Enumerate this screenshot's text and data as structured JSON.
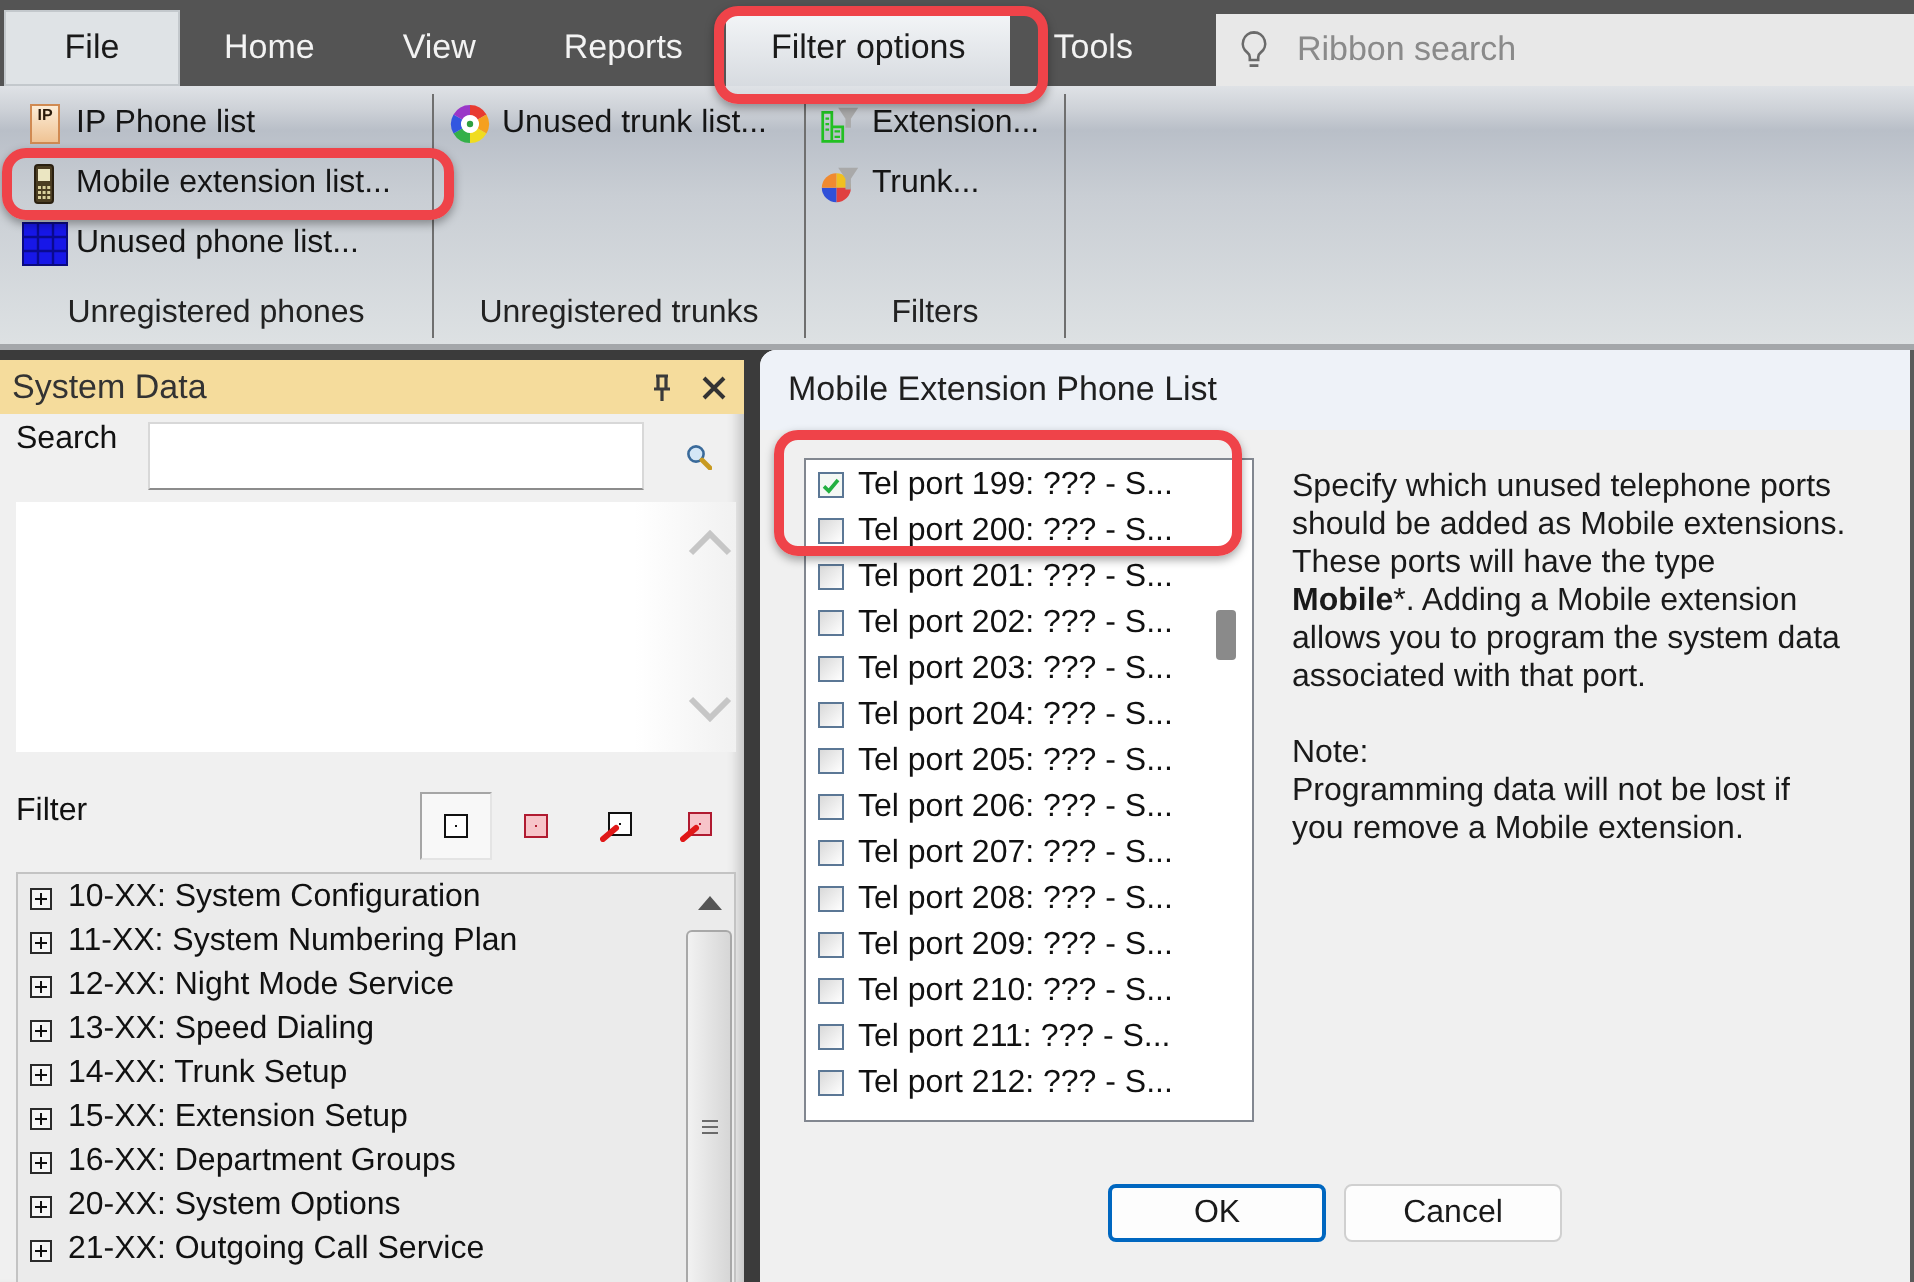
{
  "menu_bar": {
    "tabs": [
      {
        "label": "File",
        "kind": "file",
        "selected": false,
        "highlighted": false
      },
      {
        "label": "Home",
        "kind": "tab",
        "selected": false,
        "highlighted": false
      },
      {
        "label": "View",
        "kind": "tab",
        "selected": false,
        "highlighted": false
      },
      {
        "label": "Reports",
        "kind": "tab",
        "selected": false,
        "highlighted": false
      },
      {
        "label": "Filter options",
        "kind": "tab",
        "selected": true,
        "highlighted": true
      },
      {
        "label": "Tools",
        "kind": "tab",
        "selected": false,
        "highlighted": false
      }
    ],
    "search": {
      "placeholder": "Ribbon search"
    }
  },
  "ribbon": {
    "groups": [
      {
        "label": "Unregistered phones",
        "items": [
          {
            "label": "IP Phone list",
            "kind": "ip-phone",
            "icon_text": "IP",
            "highlighted": false
          },
          {
            "label": "Mobile extension list...",
            "kind": "mobile",
            "highlighted": true
          },
          {
            "label": "Unused phone list...",
            "kind": "phone-grid",
            "highlighted": false
          }
        ]
      },
      {
        "label": "Unregistered trunks",
        "items": [
          {
            "label": "Unused trunk list...",
            "kind": "trunk-ring",
            "highlighted": false
          }
        ]
      },
      {
        "label": "Filters",
        "items": [
          {
            "label": "Extension...",
            "kind": "extension-filter",
            "highlighted": false
          },
          {
            "label": "Trunk...",
            "kind": "trunk-filter",
            "highlighted": false
          }
        ]
      }
    ]
  },
  "system_data": {
    "title": "System Data",
    "search": {
      "label": "Search"
    },
    "filter": {
      "label": "Filter",
      "buttons": [
        {
          "kind": "plain",
          "selected": true
        },
        {
          "kind": "shaded",
          "selected": false
        },
        {
          "kind": "plain-pointer",
          "selected": false
        },
        {
          "kind": "shaded-pointer",
          "selected": false
        }
      ]
    },
    "tree": [
      {
        "label": "10-XX: System Configuration",
        "expanded": false
      },
      {
        "label": "11-XX: System Numbering Plan",
        "expanded": false
      },
      {
        "label": "12-XX: Night Mode Service",
        "expanded": false
      },
      {
        "label": "13-XX: Speed Dialing",
        "expanded": false
      },
      {
        "label": "14-XX: Trunk Setup",
        "expanded": false
      },
      {
        "label": "15-XX: Extension Setup",
        "expanded": false
      },
      {
        "label": "16-XX: Department Groups",
        "expanded": false
      },
      {
        "label": "20-XX: System Options",
        "expanded": false
      },
      {
        "label": "21-XX: Outgoing Call Service",
        "expanded": false
      }
    ]
  },
  "dialog": {
    "title": "Mobile Extension Phone List",
    "ports": [
      {
        "label": "Tel port 199: ??? - S...",
        "checked": true,
        "highlighted": true
      },
      {
        "label": "Tel port 200: ??? - S...",
        "checked": false,
        "highlighted": true
      },
      {
        "label": "Tel port 201: ??? - S...",
        "checked": false,
        "highlighted": false
      },
      {
        "label": "Tel port 202: ??? - S...",
        "checked": false,
        "highlighted": false
      },
      {
        "label": "Tel port 203: ??? - S...",
        "checked": false,
        "highlighted": false
      },
      {
        "label": "Tel port 204: ??? - S...",
        "checked": false,
        "highlighted": false
      },
      {
        "label": "Tel port 205: ??? - S...",
        "checked": false,
        "highlighted": false
      },
      {
        "label": "Tel port 206: ??? - S...",
        "checked": false,
        "highlighted": false
      },
      {
        "label": "Tel port 207: ??? - S...",
        "checked": false,
        "highlighted": false
      },
      {
        "label": "Tel port 208: ??? - S...",
        "checked": false,
        "highlighted": false
      },
      {
        "label": "Tel port 209: ??? - S...",
        "checked": false,
        "highlighted": false
      },
      {
        "label": "Tel port 210: ??? - S...",
        "checked": false,
        "highlighted": false
      },
      {
        "label": "Tel port 211: ??? - S...",
        "checked": false,
        "highlighted": false
      },
      {
        "label": "Tel port 212: ??? - S...",
        "checked": false,
        "highlighted": false
      }
    ],
    "description": "Specify which unused telephone ports\nshould be added as Mobile extensions.\nThese ports will have the type\n**Mobile***. Adding a Mobile extension\nallows you to program the system data\nassociated with that port.",
    "note_label": "Note:",
    "note": "Programming data will not be lost if\nyou remove a Mobile extension.",
    "buttons": [
      {
        "label": "OK",
        "kind": "default"
      },
      {
        "label": "Cancel",
        "kind": "normal"
      }
    ]
  }
}
